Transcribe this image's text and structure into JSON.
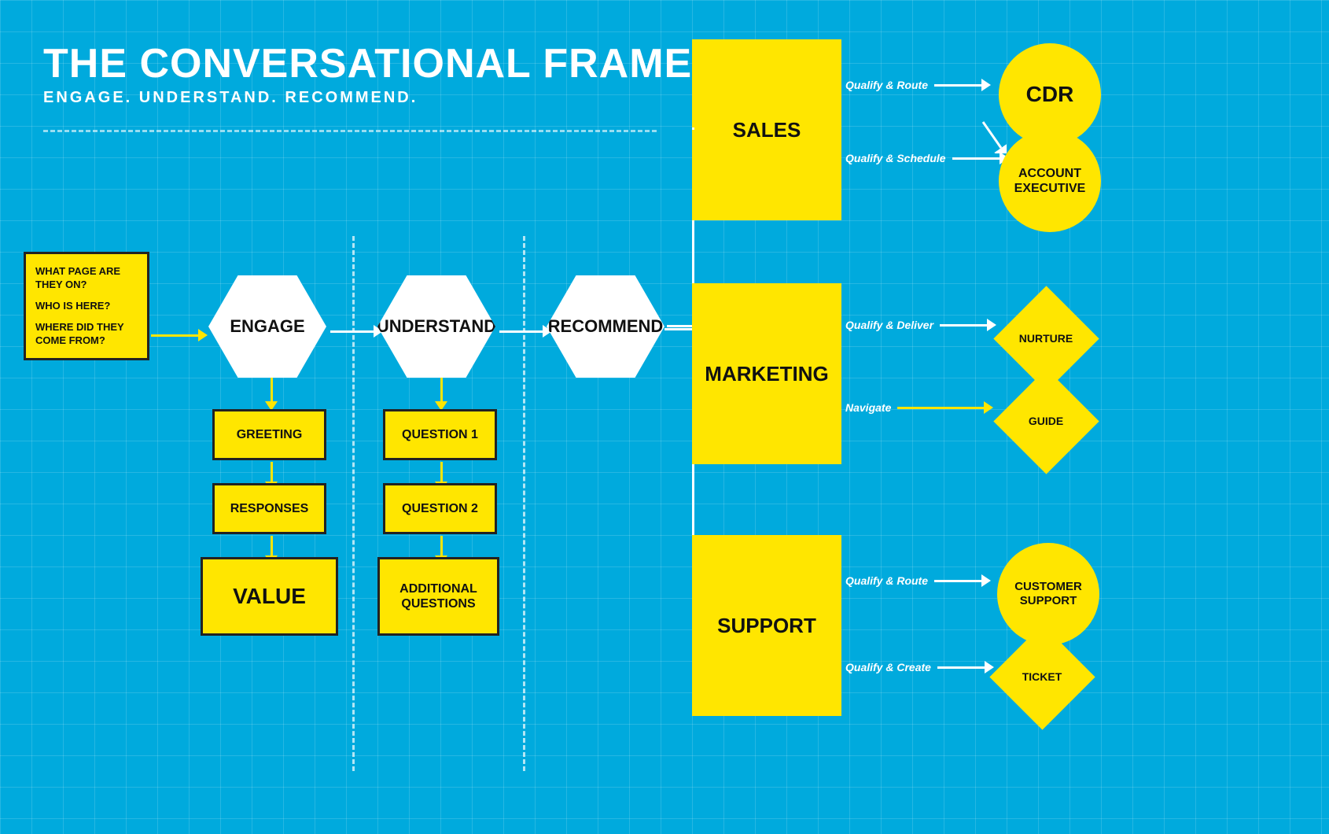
{
  "title": {
    "main": "THE CONVERSATIONAL FRAMEWORK",
    "sub": "ENGAGE. UNDERSTAND. RECOMMEND."
  },
  "questions": {
    "q1": "WHAT PAGE ARE THEY ON?",
    "q2": "WHO IS HERE?",
    "q3": "WHERE DID THEY COME FROM?"
  },
  "hexagons": {
    "engage": "ENGAGE",
    "understand": "UNDERSTAND",
    "recommend": "RECOMMEND"
  },
  "engage_flow": {
    "greeting": "GREETING",
    "responses": "RESPONSES",
    "value": "VALUE"
  },
  "understand_flow": {
    "q1": "QUESTION 1",
    "q2": "QUESTION 2",
    "additional": "ADDITIONAL QUESTIONS"
  },
  "categories": {
    "sales": "SALES",
    "marketing": "MARKETING",
    "support": "SUPPORT"
  },
  "outcomes": {
    "cdr": "CDR",
    "account_executive": "ACCOUNT EXECUTIVE",
    "nurture": "NURTURE",
    "guide": "GUIDE",
    "customer_support": "CUSTOMER SUPPORT",
    "ticket": "TICKET"
  },
  "connectors": {
    "qualify_route_1": "Qualify & Route",
    "qualify_schedule": "Qualify & Schedule",
    "qualify_deliver": "Qualify & Deliver",
    "navigate": "Navigate",
    "qualify_route_2": "Qualify & Route",
    "qualify_create": "Qualify & Create"
  }
}
